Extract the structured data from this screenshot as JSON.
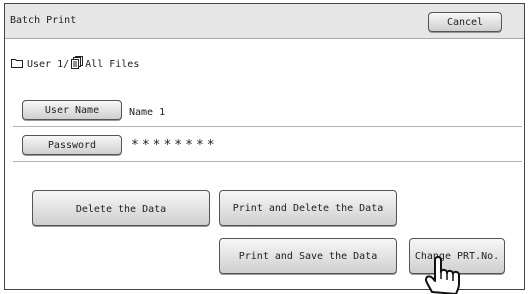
{
  "window": {
    "title": "Batch Print",
    "cancel_label": "Cancel"
  },
  "path": {
    "user_folder": "User 1/",
    "files": "All Files"
  },
  "user_name": {
    "button_label": "User Name",
    "value": "Name 1"
  },
  "password": {
    "button_label": "Password",
    "value": "********"
  },
  "actions": {
    "delete_label": "Delete the Data",
    "print_delete_label": "Print and Delete the Data",
    "print_save_label": "Print and Save the Data",
    "change_label": "Change PRT.No."
  },
  "icons": [
    "folder-icon",
    "files-icon",
    "pointer-hand-icon"
  ]
}
